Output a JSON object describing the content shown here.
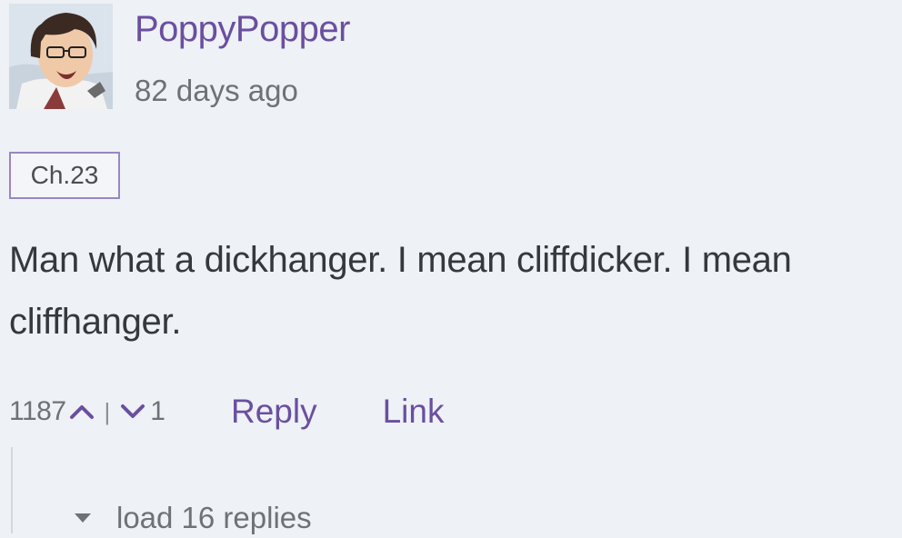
{
  "comment": {
    "username": "PoppyPopper",
    "timestamp": "82 days ago",
    "chapter_tag": "Ch.23",
    "body": "Man what a dickhanger. I mean cliffdicker. I mean cliffhanger.",
    "upvotes": "1187",
    "separator": "|",
    "downvotes": "1",
    "reply_label": "Reply",
    "link_label": "Link",
    "load_replies_label": "load 16 replies"
  },
  "icons": {
    "upvote": "chevron-up-icon",
    "downvote": "chevron-down-icon",
    "expand": "caret-down-icon"
  },
  "colors": {
    "background": "#eef1f5",
    "accent": "#6a4fa0",
    "muted_text": "#6e7278",
    "tag_border": "#9a86c4"
  }
}
